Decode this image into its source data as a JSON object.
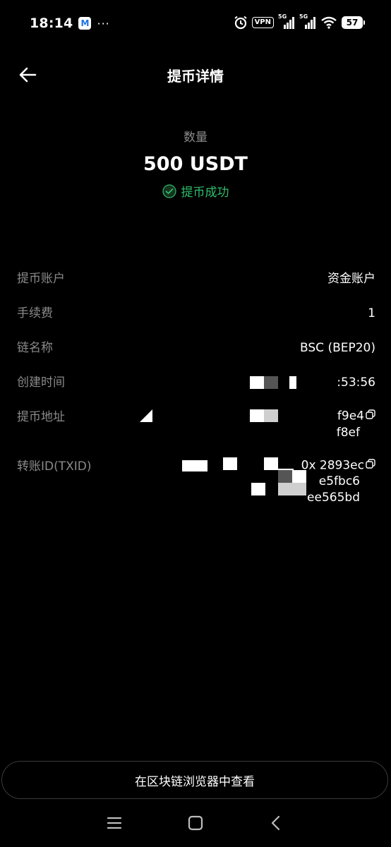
{
  "status_bar": {
    "time": "18:14",
    "notification_letter": "M",
    "more": "···",
    "vpn": "VPN",
    "network_1": "5G",
    "network_2": "5G",
    "battery": "57"
  },
  "header": {
    "title": "提币详情"
  },
  "summary": {
    "amount_label": "数量",
    "amount": "500 USDT",
    "status": "提币成功",
    "status_color": "#2ebd6b"
  },
  "details": {
    "account_label": "提币账户",
    "account_value": "资金账户",
    "fee_label": "手续费",
    "fee_value": "1",
    "chain_label": "链名称",
    "chain_value": "BSC (BEP20)",
    "created_label": "创建时间",
    "created_value": ":53:56",
    "address_label": "提币地址",
    "address_line1": "f9e4",
    "address_line2": "f8ef",
    "txid_label": "转账ID(TXID)",
    "txid_line1": "0x          2893ec",
    "txid_line2": "e5fbc6",
    "txid_line3": "ee565bd"
  },
  "actions": {
    "explorer_button": "在区块链浏览器中查看"
  },
  "nav": {
    "menu": "menu-icon",
    "home": "home-icon",
    "back": "back-icon"
  }
}
